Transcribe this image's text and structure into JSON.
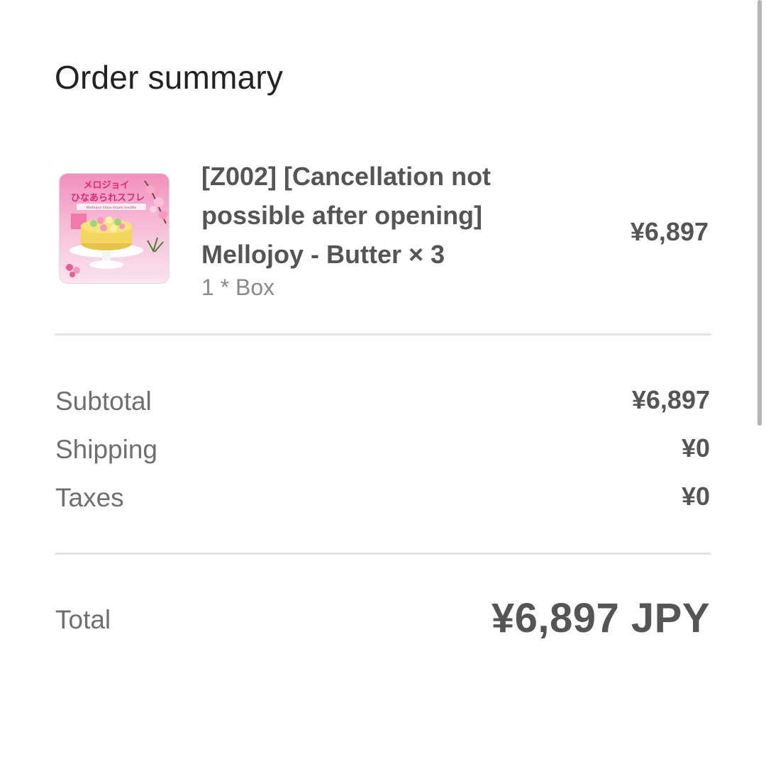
{
  "summary": {
    "title": "Order summary"
  },
  "item": {
    "name": "[Z002] [Cancellation not possible after opening] Mellojoy - Butter × 3",
    "variant": "1 * Box",
    "price": "¥6,897",
    "thumbnail": {
      "headline": "メロジョイ",
      "subheadline": "ひなあられスフレ",
      "caption": "Mellojoy Hina-Arare Souffle"
    }
  },
  "totals": {
    "subtotal_label": "Subtotal",
    "subtotal_value": "¥6,897",
    "shipping_label": "Shipping",
    "shipping_value": "¥0",
    "taxes_label": "Taxes",
    "taxes_value": "¥0",
    "total_label": "Total",
    "total_value": "¥6,897 JPY"
  },
  "colors": {
    "text_primary": "#222222",
    "text_secondary": "#6f6f6f",
    "value_text": "#555555",
    "divider": "#e4e4e4",
    "thumbnail_pink": "#f5c8dc"
  },
  "icons": {
    "product": "cake-thumbnail"
  }
}
